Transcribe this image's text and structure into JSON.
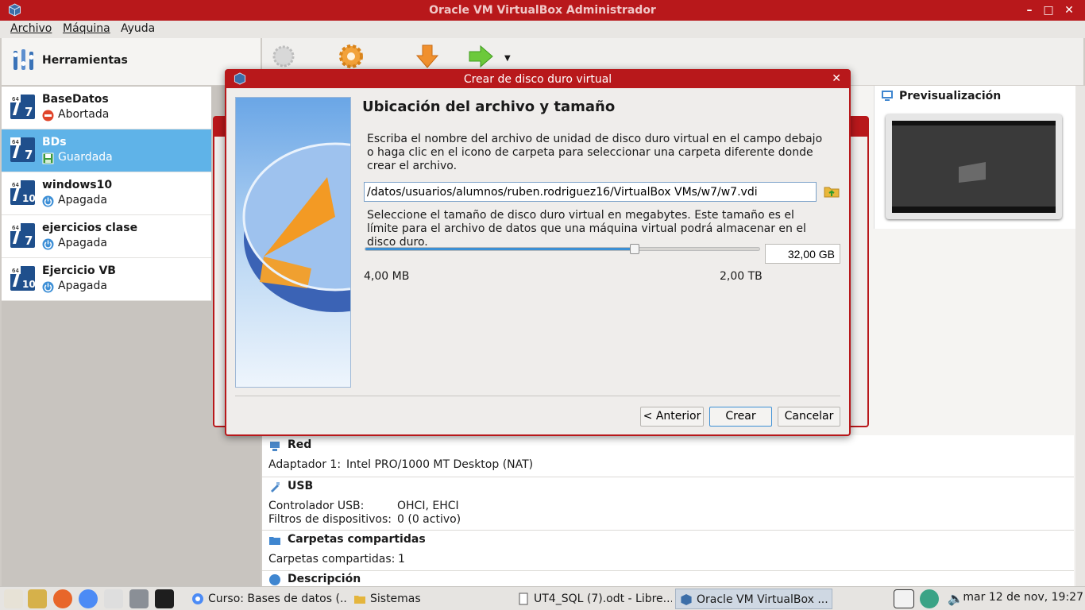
{
  "window": {
    "title": "Oracle VM VirtualBox Administrador"
  },
  "menu": [
    "Archivo",
    "Máquina",
    "Ayuda"
  ],
  "tools": {
    "label": "Herramientas"
  },
  "vms": [
    {
      "name": "BaseDatos",
      "state": "Abortada",
      "badge": "7",
      "selected": false
    },
    {
      "name": "BDs",
      "state": "Guardada",
      "badge": "7",
      "selected": true
    },
    {
      "name": "windows10",
      "state": "Apagada",
      "badge": "10",
      "selected": false
    },
    {
      "name": "ejercicios clase",
      "state": "Apagada",
      "badge": "7",
      "selected": false
    },
    {
      "name": "Ejercicio VB",
      "state": "Apagada",
      "badge": "10",
      "selected": false
    }
  ],
  "preview": {
    "title": "Previsualización"
  },
  "details": {
    "red": {
      "title": "Red",
      "adapter_label": "Adaptador 1:",
      "adapter_value": "Intel PRO/1000 MT Desktop (NAT)"
    },
    "usb": {
      "title": "USB",
      "ctrl_label": "Controlador USB:",
      "ctrl_value": "OHCI, EHCI",
      "filters_label": "Filtros de dispositivos:",
      "filters_value": "0 (0 activo)"
    },
    "shared": {
      "title": "Carpetas compartidas",
      "label": "Carpetas compartidas:",
      "value": "1"
    },
    "desc": {
      "title": "Descripción"
    }
  },
  "dialog": {
    "title": "Crear de disco duro virtual",
    "heading": "Ubicación del archivo y tamaño",
    "para1": "Escriba el nombre del archivo de unidad de disco duro virtual en el campo debajo o haga clic en el icono de carpeta para seleccionar una carpeta diferente donde crear el archivo.",
    "path": "/datos/usuarios/alumnos/ruben.rodriguez16/VirtualBox VMs/w7/w7.vdi",
    "para2": "Seleccione el tamaño de disco duro virtual en megabytes. Este tamaño es el límite para el archivo de datos que una máquina virtual podrá almacenar en el disco duro.",
    "slider_fraction": 0.68,
    "size": "32,00 GB",
    "min_label": "4,00 MB",
    "max_label": "2,00 TB",
    "buttons": {
      "back": "< Anterior",
      "create": "Crear",
      "cancel": "Cancelar"
    }
  },
  "taskbar": {
    "tasks": [
      {
        "label": "Curso: Bases de datos (...",
        "active": false
      },
      {
        "label": "Sistemas",
        "active": false
      },
      {
        "label": "UT4_SQL (7).odt - Libre...",
        "active": false
      },
      {
        "label": "Oracle VM VirtualBox ...",
        "active": true
      }
    ],
    "clock": "mar 12 de nov, 19:27"
  }
}
